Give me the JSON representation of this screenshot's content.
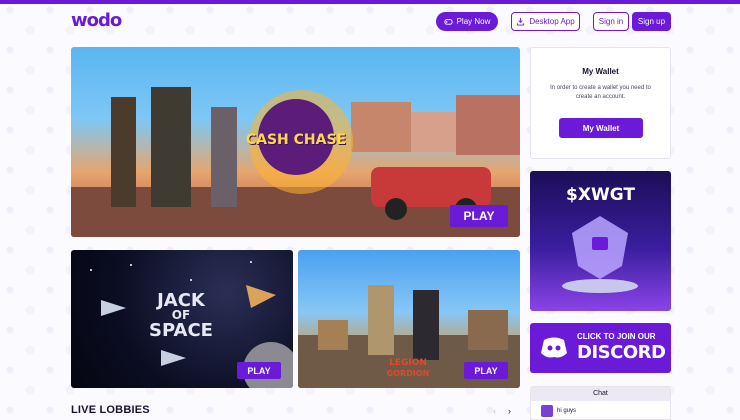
{
  "header": {
    "logo": "wodo",
    "play_now": "Play Now",
    "desktop_app": "Desktop App",
    "sign_in": "Sign in",
    "sign_up": "Sign up"
  },
  "hero": {
    "title": "CASH CHASE",
    "play": "PLAY"
  },
  "cards": [
    {
      "title_line1": "JACK",
      "title_line2": "OF",
      "title_line3": "SPACE",
      "play": "PLAY"
    },
    {
      "title_line1": "LEGION",
      "title_line2": "GORDION",
      "play": "PLAY"
    }
  ],
  "wallet": {
    "title": "My Wallet",
    "description": "In order to create a wallet you need to create an account.",
    "button": "My Wallet"
  },
  "token": {
    "title": "$XWGT"
  },
  "discord": {
    "line1": "CLICK TO JOIN OUR",
    "line2": "DISCORD"
  },
  "chat": {
    "title": "Chat",
    "message": "hi guys"
  },
  "section": {
    "live_lobbies": "LIVE LOBBIES"
  },
  "colors": {
    "accent": "#6b1bd8"
  },
  "icons": [
    "gamepad-icon",
    "download-icon",
    "discord-icon",
    "chevron-left-icon",
    "chevron-right-icon"
  ]
}
